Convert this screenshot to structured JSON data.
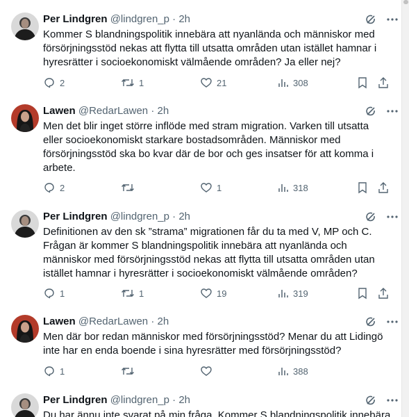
{
  "tweets": [
    {
      "name": "Per Lindgren",
      "handle": "@lindgren_p",
      "dot": "·",
      "time": "2h",
      "text": "Kommer S blandningspolitik innebära att nyanlända och människor med försörjningsstöd nekas att flytta till utsatta områden utan istället hamnar i hyresrätter i socioekonomiskt välmående områden? Ja eller nej?",
      "replies": "2",
      "retweets": "1",
      "likes": "21",
      "views": "308",
      "avatar": "per"
    },
    {
      "name": "Lawen",
      "handle": "@RedarLawen",
      "dot": "·",
      "time": "2h",
      "text": "Men det blir inget större inflöde med stram migration. Varken till utsatta eller socioekonomiskt starkare bostadsområden. Människor med försörjningsstöd ska bo kvar där de bor och ges insatser för att komma i arbete.",
      "replies": "2",
      "retweets": "",
      "likes": "1",
      "views": "318",
      "avatar": "lawen"
    },
    {
      "name": "Per Lindgren",
      "handle": "@lindgren_p",
      "dot": "·",
      "time": "2h",
      "text": "Definitionen av den sk ”strama” migrationen får du ta med V, MP och C. Frågan är kommer S blandningspolitik innebära att nyanlända och människor med försörjningsstöd nekas att flytta till utsatta områden utan istället hamnar i hyresrätter i socioekonomiskt välmående områden?",
      "replies": "1",
      "retweets": "1",
      "likes": "19",
      "views": "319",
      "avatar": "per"
    },
    {
      "name": "Lawen",
      "handle": "@RedarLawen",
      "dot": "·",
      "time": "2h",
      "text": "Men där bor redan människor med försörjningsstöd? Menar du att Lidingö inte har en enda boende i sina hyresrätter med försörjningsstöd?",
      "replies": "1",
      "retweets": "",
      "likes": "",
      "views": "388",
      "avatar": "lawen"
    },
    {
      "name": "Per Lindgren",
      "handle": "@lindgren_p",
      "dot": "·",
      "time": "2h",
      "text": "Du har ännu inte svarat på min fråga. Kommer S blandningspolitik innebära",
      "replies": "",
      "retweets": "",
      "likes": "",
      "views": "",
      "avatar": "per"
    }
  ],
  "icons": {
    "grok": "grok-icon",
    "more": "more-icon",
    "reply": "reply-icon",
    "retweet": "retweet-icon",
    "like": "like-icon",
    "views": "views-icon",
    "bookmark": "bookmark-icon",
    "share": "share-icon"
  },
  "colors": {
    "text": "#0f1419",
    "secondary": "#536471",
    "background": "#ffffff"
  }
}
